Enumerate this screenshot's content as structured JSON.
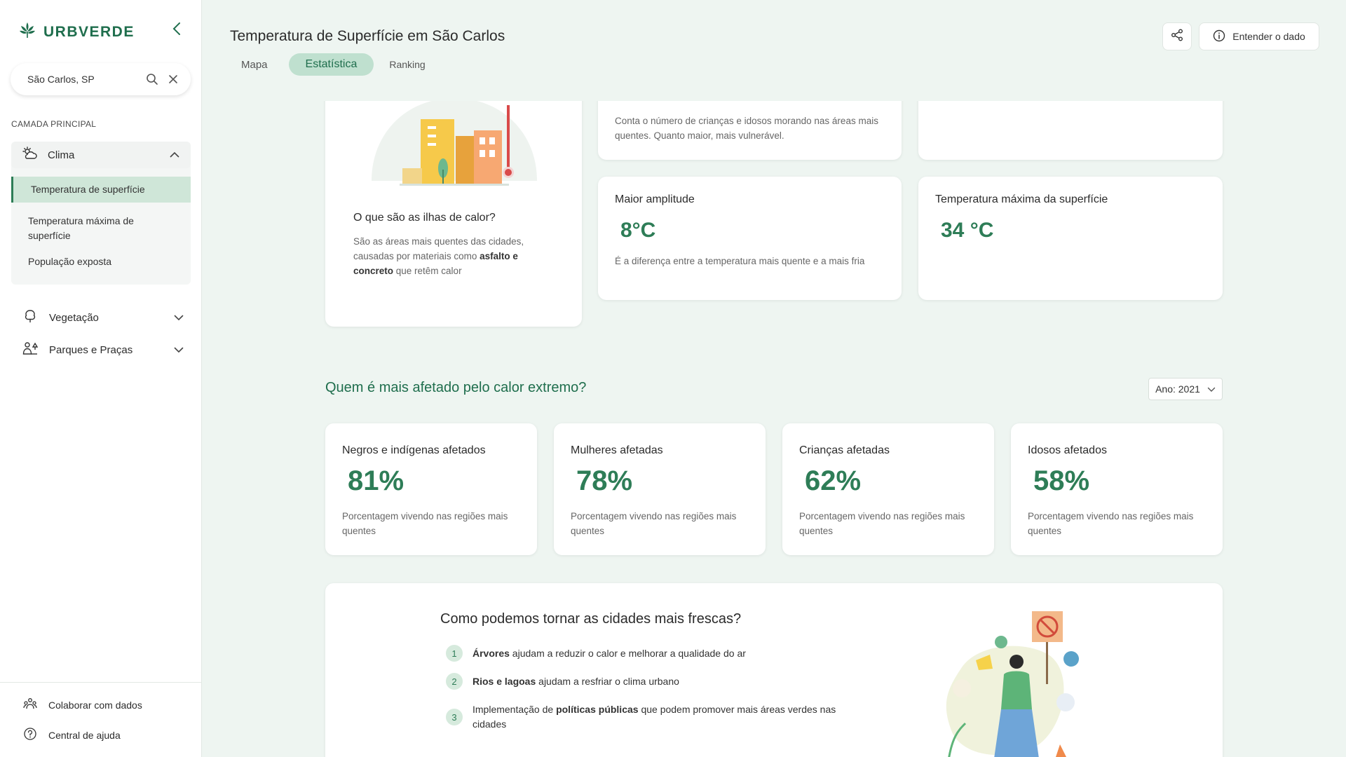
{
  "app": {
    "brand": "URBVERDE"
  },
  "search": {
    "value": "São Carlos, SP"
  },
  "sidebar": {
    "section_label": "CAMADA PRINCIPAL",
    "clima": {
      "label": "Clima",
      "items": [
        "Temperatura de superfície",
        "Temperatura máxima de superfície",
        "População exposta"
      ]
    },
    "vegetacao": "Vegetação",
    "parques": "Parques e Praças",
    "footer": {
      "colaborar": "Colaborar com dados",
      "ajuda": "Central de ajuda"
    }
  },
  "header": {
    "title": "Temperatura de Superfície em São Carlos",
    "tabs": [
      "Mapa",
      "Estatística",
      "Ranking"
    ],
    "info_button": "Entender o dado"
  },
  "intro_card": {
    "title": "O que são as ilhas de calor?",
    "desc_pre": "São as áreas mais quentes das cidades, causadas por materiais como ",
    "desc_bold": "asfalto e concreto",
    "desc_post": " que retêm calor"
  },
  "top_cards": {
    "vulnerable_desc": "Conta o número de crianças e idosos morando nas áreas mais quentes. Quanto maior, mais vulnerável.",
    "amplitude": {
      "title": "Maior amplitude",
      "value": "8°C",
      "desc": "É a diferença entre a temperatura mais quente e a mais fria"
    },
    "max_temp": {
      "title": "Temperatura máxima da superfície",
      "value": "34 °C"
    }
  },
  "affected": {
    "heading": "Quem é mais afetado pelo calor extremo?",
    "year_select": "Ano: 2021",
    "cards": [
      {
        "title": "Negros e indígenas afetados",
        "value": "81%",
        "desc": "Porcentagem vivendo nas regiões mais quentes"
      },
      {
        "title": "Mulheres afetadas",
        "value": "78%",
        "desc": "Porcentagem vivendo nas regiões mais quentes"
      },
      {
        "title": "Crianças afetadas",
        "value": "62%",
        "desc": "Porcentagem vivendo nas regiões mais quentes"
      },
      {
        "title": "Idosos afetados",
        "value": "58%",
        "desc": "Porcentagem vivendo nas regiões mais quentes"
      }
    ]
  },
  "cooler": {
    "title": "Como podemos tornar as cidades mais frescas?",
    "items": [
      {
        "num": "1",
        "bold": "Árvores",
        "text": " ajudam a reduzir o calor e melhorar a qualidade do ar"
      },
      {
        "num": "2",
        "bold": "Rios e lagoas",
        "text": " ajudam a resfriar o clima urbano"
      },
      {
        "num": "3",
        "pre": "Implementação de ",
        "bold": "políticas públicas",
        "text": " que podem promover mais áreas verdes nas cidades"
      }
    ]
  },
  "colors": {
    "accent": "#2e7d57",
    "brand": "#1f6e4d",
    "background": "#eef5f1",
    "tab_active": "#bfe0cf"
  }
}
